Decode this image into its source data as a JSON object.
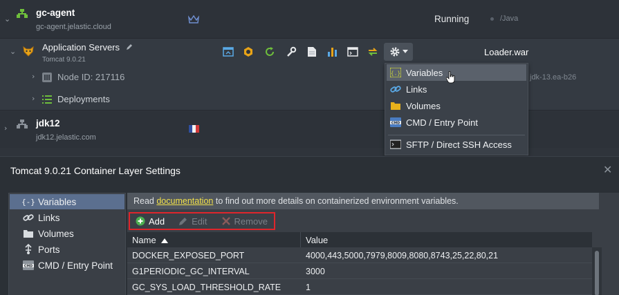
{
  "env1": {
    "name": "gc-agent",
    "domain": "gc-agent.jelastic.cloud",
    "status": "Running",
    "tag": "/Java"
  },
  "app_servers": {
    "title": "Application Servers",
    "subtitle": "Tomcat 9.0.21",
    "deploy_file": "Loader.war",
    "node_id": "Node ID: 217116",
    "node_tag": "jdk-13.ea-b26",
    "deployments": "Deployments"
  },
  "env2": {
    "name": "jdk12",
    "domain": "jdk12.jelastic.com"
  },
  "config_menu": {
    "items": [
      {
        "label": "Variables",
        "icon": "variables-icon"
      },
      {
        "label": "Links",
        "icon": "link-icon"
      },
      {
        "label": "Volumes",
        "icon": "folder-icon"
      },
      {
        "label": "CMD / Entry Point",
        "icon": "cmd-icon"
      },
      {
        "label": "SFTP / Direct SSH Access",
        "icon": "terminal-icon"
      }
    ],
    "active_index": 0
  },
  "dialog": {
    "title": "Tomcat 9.0.21 Container Layer Settings",
    "close": "✕",
    "sidebar": [
      {
        "label": "Variables",
        "icon": "variables-icon"
      },
      {
        "label": "Links",
        "icon": "link-icon"
      },
      {
        "label": "Volumes",
        "icon": "folder-icon"
      },
      {
        "label": "Ports",
        "icon": "ports-icon"
      },
      {
        "label": "CMD / Entry Point",
        "icon": "cmd-icon"
      }
    ],
    "info_before": "Read ",
    "info_link": "documentation",
    "info_after": " to find out more details on containerized environment variables.",
    "toolbar": {
      "add": "Add",
      "edit": "Edit",
      "remove": "Remove"
    },
    "columns": {
      "name": "Name",
      "value": "Value"
    },
    "rows": [
      {
        "name": "DOCKER_EXPOSED_PORT",
        "value": "4000,443,5000,7979,8009,8080,8743,25,22,80,21"
      },
      {
        "name": "G1PERIODIC_GC_INTERVAL",
        "value": "3000"
      },
      {
        "name": "GC_SYS_LOAD_THRESHOLD_RATE",
        "value": "1"
      }
    ]
  },
  "colors": {
    "accent_yellow": "#f2e14a",
    "highlight_red": "#e0252b",
    "active_blue": "#5b6f8f"
  }
}
